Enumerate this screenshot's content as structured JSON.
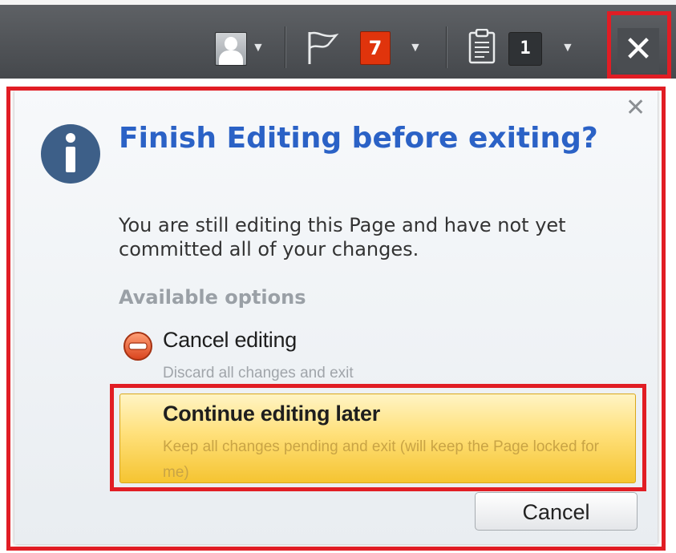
{
  "toolbar": {
    "notification_count": "7",
    "clipboard_count": "1",
    "close_glyph": "✕",
    "icons": [
      "user-avatar-icon",
      "chevron-down-icon",
      "flag-icon",
      "clipboard-icon",
      "close-icon"
    ]
  },
  "dialog": {
    "close_glyph": "✕",
    "title": "Finish Editing before exiting?",
    "message": "You are still editing this Page and have not yet committed all of your changes.",
    "options_heading": "Available options",
    "options": [
      {
        "label": "Cancel editing",
        "description": "Discard all changes and exit",
        "icon": "minus-circle-icon"
      },
      {
        "label": "Continue editing later",
        "description": "Keep all changes pending and exit (will keep the Page locked for me)",
        "selected": true
      }
    ],
    "cancel_label": "Cancel"
  },
  "colors": {
    "toolbar_bg": "#505357",
    "title": "#2b62c6",
    "highlight_border": "#e11d24",
    "badge_red": "#e0340c",
    "selected_option": "#ffe07a"
  }
}
